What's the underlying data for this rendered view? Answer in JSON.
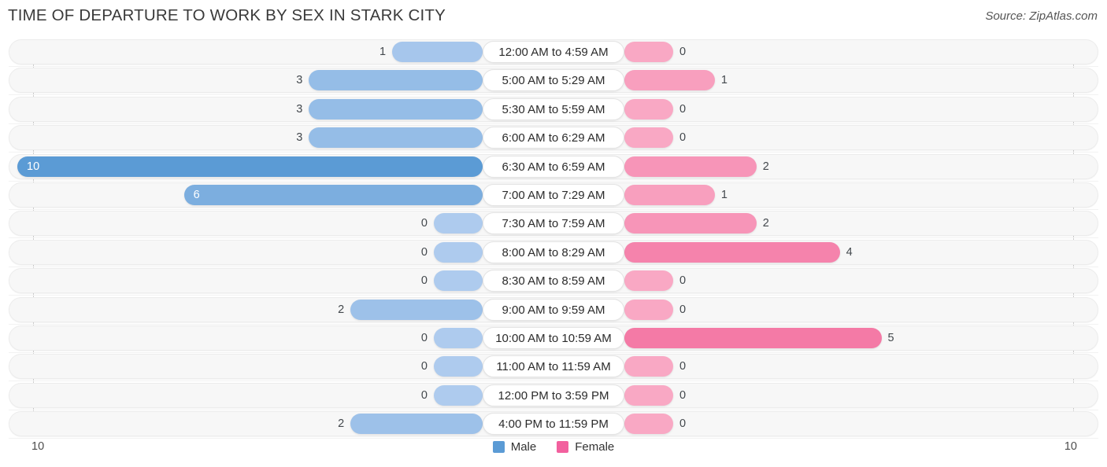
{
  "header": {
    "title": "TIME OF DEPARTURE TO WORK BY SEX IN STARK CITY",
    "source": "Source: ZipAtlas.com"
  },
  "axis": {
    "left_tick": "10",
    "right_tick": "10"
  },
  "legend": {
    "items": [
      {
        "label": "Male",
        "color": "#5b9bd5"
      },
      {
        "label": "Female",
        "color": "#f2609e"
      }
    ]
  },
  "colors": {
    "male_max": "#5b9bd5",
    "male_min": "#aecbee",
    "female_max": "#ef4b88",
    "female_min": "#f9a8c4",
    "track": "#f7f7f7",
    "axis_line": "#cfcfcf",
    "title_text": "#3a3a3a"
  },
  "chart_data": {
    "type": "bar",
    "title": "TIME OF DEPARTURE TO WORK BY SEX IN STARK CITY",
    "subtitle": "Source: ZipAtlas.com",
    "orientation": "horizontal-diverging",
    "xlabel": "",
    "ylabel": "",
    "xlim": [
      10,
      10
    ],
    "grid": false,
    "legend_position": "bottom-center",
    "categories": [
      "12:00 AM to 4:59 AM",
      "5:00 AM to 5:29 AM",
      "5:30 AM to 5:59 AM",
      "6:00 AM to 6:29 AM",
      "6:30 AM to 6:59 AM",
      "7:00 AM to 7:29 AM",
      "7:30 AM to 7:59 AM",
      "8:00 AM to 8:29 AM",
      "8:30 AM to 8:59 AM",
      "9:00 AM to 9:59 AM",
      "10:00 AM to 10:59 AM",
      "11:00 AM to 11:59 AM",
      "12:00 PM to 3:59 PM",
      "4:00 PM to 11:59 PM"
    ],
    "series": [
      {
        "name": "Male",
        "values": [
          1,
          3,
          3,
          3,
          10,
          6,
          0,
          0,
          0,
          2,
          0,
          0,
          0,
          2
        ]
      },
      {
        "name": "Female",
        "values": [
          0,
          1,
          0,
          0,
          2,
          1,
          2,
          4,
          0,
          0,
          5,
          0,
          0,
          0
        ]
      }
    ]
  },
  "rows": [
    {
      "label": "12:00 AM to 4:59 AM",
      "male": "1",
      "female": "0"
    },
    {
      "label": "5:00 AM to 5:29 AM",
      "male": "3",
      "female": "1"
    },
    {
      "label": "5:30 AM to 5:59 AM",
      "male": "3",
      "female": "0"
    },
    {
      "label": "6:00 AM to 6:29 AM",
      "male": "3",
      "female": "0"
    },
    {
      "label": "6:30 AM to 6:59 AM",
      "male": "10",
      "female": "2"
    },
    {
      "label": "7:00 AM to 7:29 AM",
      "male": "6",
      "female": "1"
    },
    {
      "label": "7:30 AM to 7:59 AM",
      "male": "0",
      "female": "2"
    },
    {
      "label": "8:00 AM to 8:29 AM",
      "male": "0",
      "female": "4"
    },
    {
      "label": "8:30 AM to 8:59 AM",
      "male": "0",
      "female": "0"
    },
    {
      "label": "9:00 AM to 9:59 AM",
      "male": "2",
      "female": "0"
    },
    {
      "label": "10:00 AM to 10:59 AM",
      "male": "0",
      "female": "5"
    },
    {
      "label": "11:00 AM to 11:59 AM",
      "male": "0",
      "female": "0"
    },
    {
      "label": "12:00 PM to 3:59 PM",
      "male": "0",
      "female": "0"
    },
    {
      "label": "4:00 PM to 11:59 PM",
      "male": "2",
      "female": "0"
    }
  ]
}
